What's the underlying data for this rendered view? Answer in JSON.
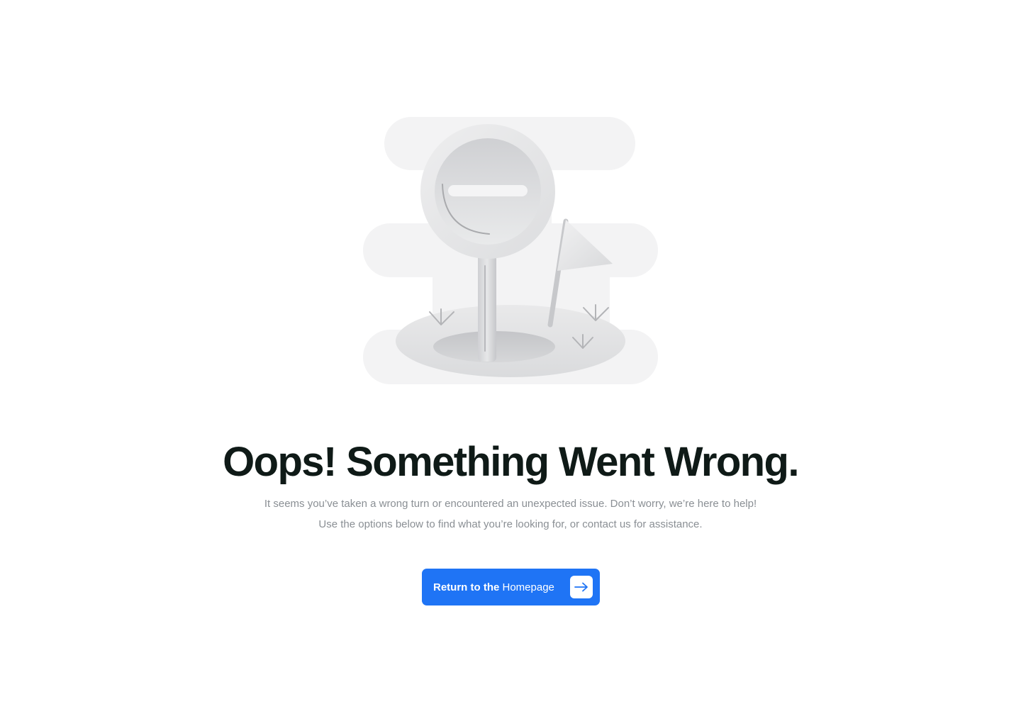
{
  "error_page": {
    "title": "Oops! Something Went Wrong.",
    "description": "It seems you’ve taken a wrong turn or encountered an unexpected issue. Don’t worry, we’re here to help! Use the options below to find what you’re looking for, or contact us for assistance.",
    "button": {
      "label_strong": "Return to the",
      "label_light": " Homepage",
      "icon": "arrow-right-icon"
    },
    "illustration": {
      "description_icon": "no-entry-sign-illustration"
    }
  },
  "colors": {
    "accent": "#1f74f5",
    "title": "#0f1a17",
    "body_text": "#8a8f94",
    "illustration_gray": "#e6e7e9"
  }
}
